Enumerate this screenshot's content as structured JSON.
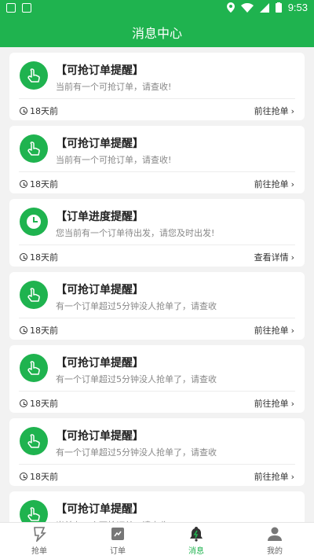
{
  "status_bar": {
    "time": "9:53"
  },
  "header": {
    "title": "消息中心"
  },
  "messages": [
    {
      "icon": "hand-tap-icon",
      "title": "【可抢订单提醒】",
      "desc": "当前有一个可抢订单，请查收!",
      "time": "18天前",
      "action": "前往抢单"
    },
    {
      "icon": "hand-tap-icon",
      "title": "【可抢订单提醒】",
      "desc": "当前有一个可抢订单，请查收!",
      "time": "18天前",
      "action": "前往抢单"
    },
    {
      "icon": "clock-icon",
      "title": "【订单进度提醒】",
      "desc": "您当前有一个订单待出发，请您及时出发!",
      "time": "18天前",
      "action": "查看详情"
    },
    {
      "icon": "hand-tap-icon",
      "title": "【可抢订单提醒】",
      "desc": "有一个订单超过5分钟没人抢单了，请查收",
      "time": "18天前",
      "action": "前往抢单"
    },
    {
      "icon": "hand-tap-icon",
      "title": "【可抢订单提醒】",
      "desc": "有一个订单超过5分钟没人抢单了，请查收",
      "time": "18天前",
      "action": "前往抢单"
    },
    {
      "icon": "hand-tap-icon",
      "title": "【可抢订单提醒】",
      "desc": "有一个订单超过5分钟没人抢单了，请查收",
      "time": "18天前",
      "action": "前往抢单"
    },
    {
      "icon": "hand-tap-icon",
      "title": "【可抢订单提醒】",
      "desc": "当前有一个可抢订单，请查收!",
      "time": "",
      "action": ""
    }
  ],
  "tabs": [
    {
      "label": "抢单",
      "icon": "grab-order-icon",
      "active": false
    },
    {
      "label": "订单",
      "icon": "order-icon",
      "active": false
    },
    {
      "label": "消息",
      "icon": "bell-icon",
      "active": true
    },
    {
      "label": "我的",
      "icon": "profile-icon",
      "active": false
    }
  ],
  "colors": {
    "brand": "#1fb34f",
    "background": "#f2f2f2"
  }
}
